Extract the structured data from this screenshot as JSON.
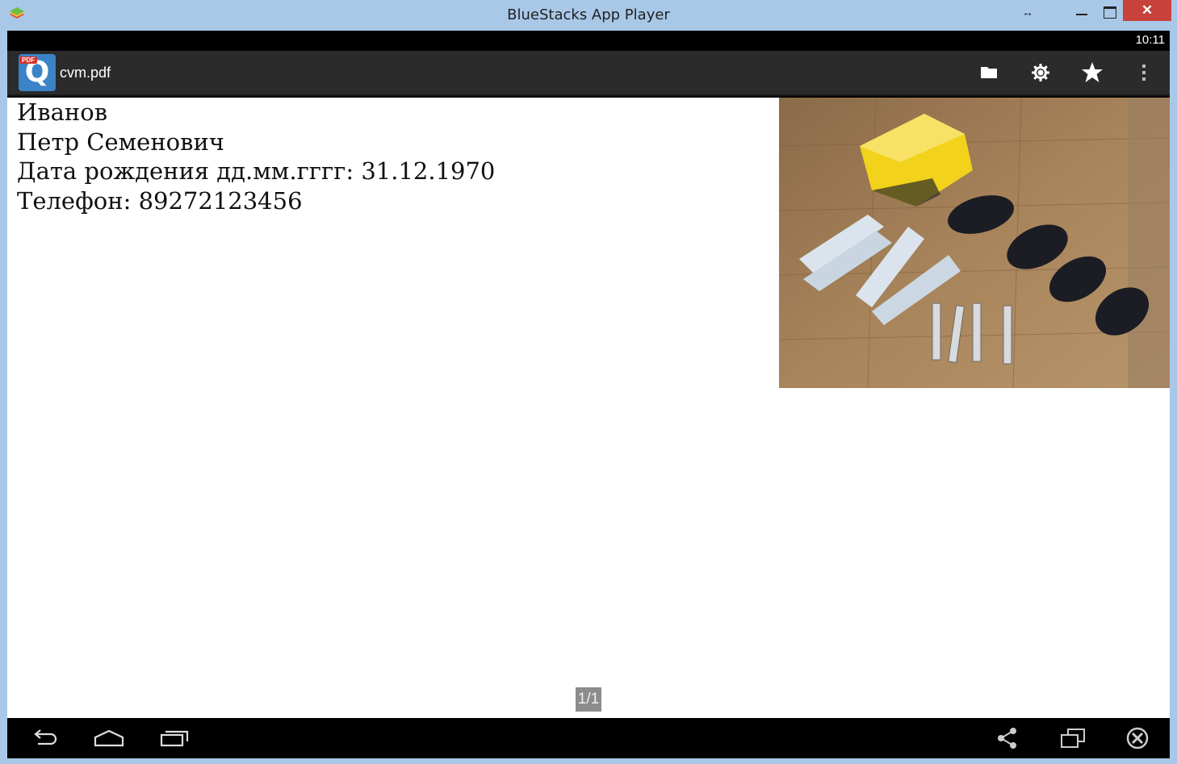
{
  "window": {
    "title": "BlueStacks App Player",
    "close_glyph": "✕",
    "resize_glyph": "↔"
  },
  "status_bar": {
    "time": "10:11"
  },
  "action_bar": {
    "app_icon_letter": "Q",
    "app_icon_badge": "PDF",
    "title": "cvm.pdf",
    "actions": [
      "folder-icon",
      "settings-icon",
      "bookmark-star-icon",
      "overflow-menu-icon"
    ]
  },
  "document": {
    "lines": [
      "Иванов",
      "Петр Семенович",
      "Дата рождения дд.мм.гггг: 31.12.1970",
      "Телефон: 89272123456"
    ],
    "photo_description_icon": "photo-brake-pads-and-spark-plugs",
    "page_indicator": "1/1"
  },
  "nav_bar": {
    "items": [
      "back-icon",
      "home-icon",
      "recent-apps-icon",
      "share-icon",
      "screen-rotate-icon",
      "close-app-icon"
    ]
  },
  "colors": {
    "titlebar": "#a9c8e8",
    "close_button": "#c7423a",
    "action_bar": "#2b2b2b",
    "app_icon": "#3b83c7"
  }
}
